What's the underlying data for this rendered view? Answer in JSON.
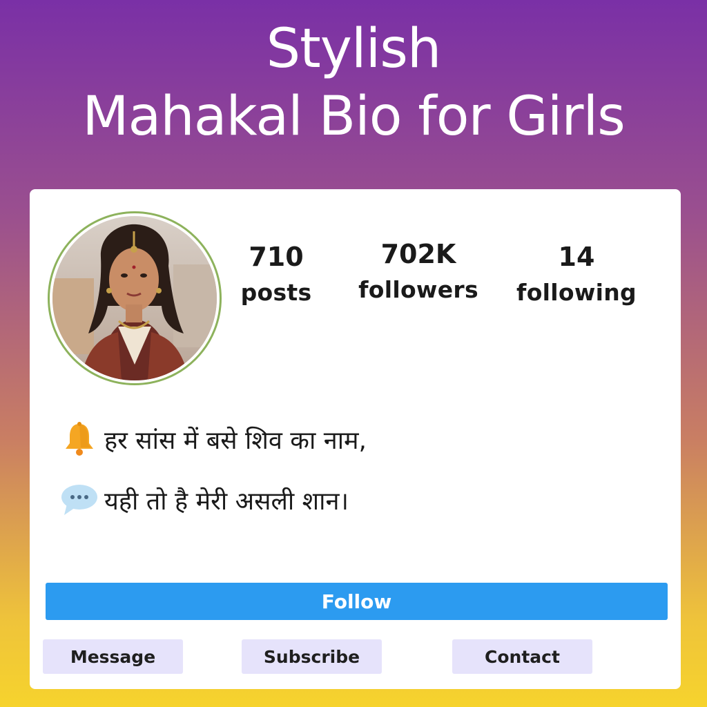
{
  "headline": {
    "line1": "Stylish",
    "line2": "Mahakal Bio for Girls"
  },
  "profile": {
    "avatar_icon": "avatar-photo",
    "stats": [
      {
        "value": "710",
        "label": "posts"
      },
      {
        "value": "702K",
        "label": "followers"
      },
      {
        "value": "14",
        "label": "following"
      }
    ]
  },
  "bio": {
    "lines": [
      {
        "icon": "bell-icon",
        "text": "हर सांस में बसे शिव का नाम,"
      },
      {
        "icon": "speech-bubble-icon",
        "text": "यही तो है मेरी असली शान।"
      }
    ]
  },
  "actions": {
    "follow_label": "Follow",
    "message_label": "Message",
    "subscribe_label": "Subscribe",
    "contact_label": "Contact"
  },
  "colors": {
    "follow_button": "#2c9bf0",
    "secondary_button": "#e6e3fb",
    "avatar_ring": "#8db25c"
  }
}
